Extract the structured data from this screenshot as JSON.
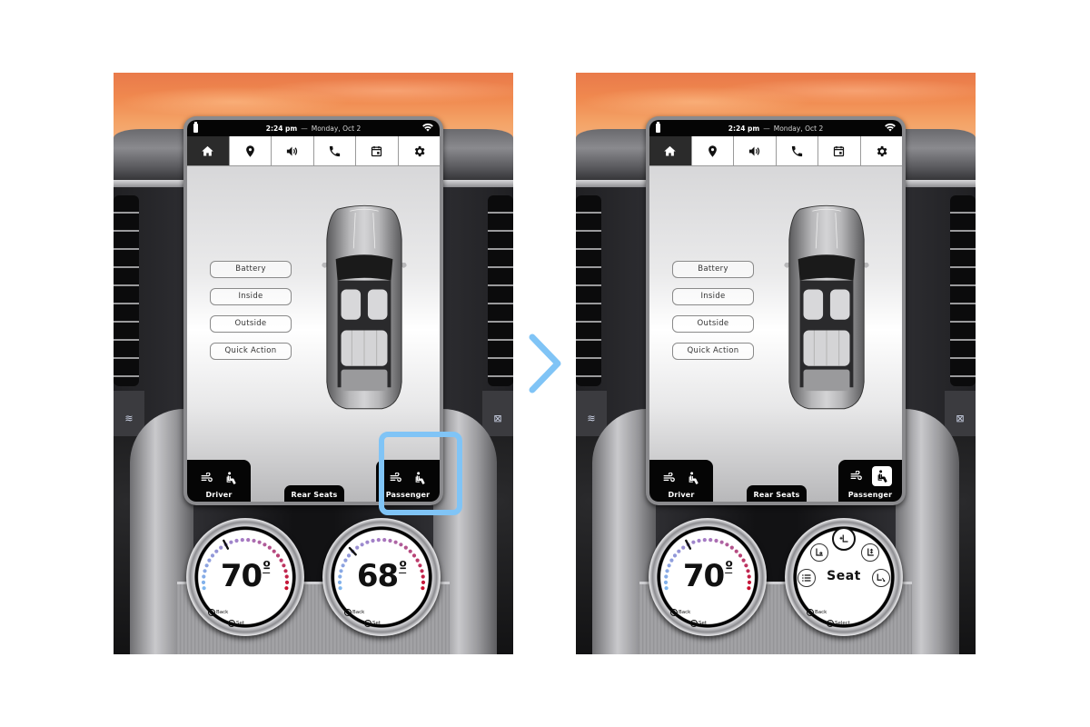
{
  "panels": [
    {
      "id": "before",
      "status_bar": {
        "time": "2:24 pm",
        "separator": "—",
        "date": "Monday, Oct 2"
      },
      "nav_tabs": [
        {
          "icon": "home-icon",
          "label": "Home",
          "active": true
        },
        {
          "icon": "location-pin-icon",
          "label": "Navigation",
          "active": false
        },
        {
          "icon": "volume-icon",
          "label": "Audio",
          "active": false
        },
        {
          "icon": "phone-icon",
          "label": "Phone",
          "active": false
        },
        {
          "icon": "calendar-icon",
          "label": "Calendar",
          "active": false
        },
        {
          "icon": "gear-icon",
          "label": "Settings",
          "active": false
        }
      ],
      "menu": [
        "Battery",
        "Inside",
        "Outside",
        "Quick Action"
      ],
      "zones": {
        "driver": {
          "label": "Driver",
          "icons": [
            "fan-airflow-icon",
            "seat-icon"
          ],
          "seat_selected": false
        },
        "rear": {
          "label": "Rear Seats"
        },
        "passenger": {
          "label": "Passenger",
          "icons": [
            "fan-airflow-icon",
            "seat-icon"
          ],
          "seat_selected": false
        }
      },
      "dials": [
        {
          "type": "temperature",
          "value": "70",
          "unit": "º",
          "setpoint_fraction": 0.36,
          "hints": {
            "back": "Back",
            "set": "Set"
          }
        },
        {
          "type": "temperature",
          "value": "68",
          "unit": "º",
          "setpoint_fraction": 0.28,
          "hints": {
            "back": "Back",
            "set": "Set"
          }
        }
      ]
    },
    {
      "id": "after",
      "status_bar": {
        "time": "2:24 pm",
        "separator": "—",
        "date": "Monday, Oct 2"
      },
      "nav_tabs": [
        {
          "icon": "home-icon",
          "label": "Home",
          "active": true
        },
        {
          "icon": "location-pin-icon",
          "label": "Navigation",
          "active": false
        },
        {
          "icon": "volume-icon",
          "label": "Audio",
          "active": false
        },
        {
          "icon": "phone-icon",
          "label": "Phone",
          "active": false
        },
        {
          "icon": "calendar-icon",
          "label": "Calendar",
          "active": false
        },
        {
          "icon": "gear-icon",
          "label": "Settings",
          "active": false
        }
      ],
      "menu": [
        "Battery",
        "Inside",
        "Outside",
        "Quick Action"
      ],
      "zones": {
        "driver": {
          "label": "Driver",
          "icons": [
            "fan-airflow-icon",
            "seat-icon"
          ],
          "seat_selected": false
        },
        "rear": {
          "label": "Rear Seats"
        },
        "passenger": {
          "label": "Passenger",
          "icons": [
            "fan-airflow-icon",
            "seat-icon"
          ],
          "seat_selected": true
        }
      },
      "dials": [
        {
          "type": "temperature",
          "value": "70",
          "unit": "º",
          "setpoint_fraction": 0.36,
          "hints": {
            "back": "Back",
            "set": "Set"
          }
        },
        {
          "type": "seat-menu",
          "title": "Seat",
          "options": [
            "seat-recline-icon",
            "seat-lumbar-icon",
            "seat-height-icon",
            "seat-tilt-icon",
            "seat-list-icon"
          ],
          "active_option": "seat-lumbar-icon",
          "hints": {
            "back": "Back",
            "set": "Select"
          }
        }
      ]
    }
  ],
  "annotations": {
    "highlight_target": "passenger-seat-button",
    "highlight_color": "#80c4f6",
    "transition_arrow_color": "#80c4f6"
  },
  "colors": {
    "dial_cool": "#7fb6ee",
    "dial_mid": "#a77ac3",
    "dial_warm": "#c8102e",
    "active_tab": "#2b2b2b"
  }
}
